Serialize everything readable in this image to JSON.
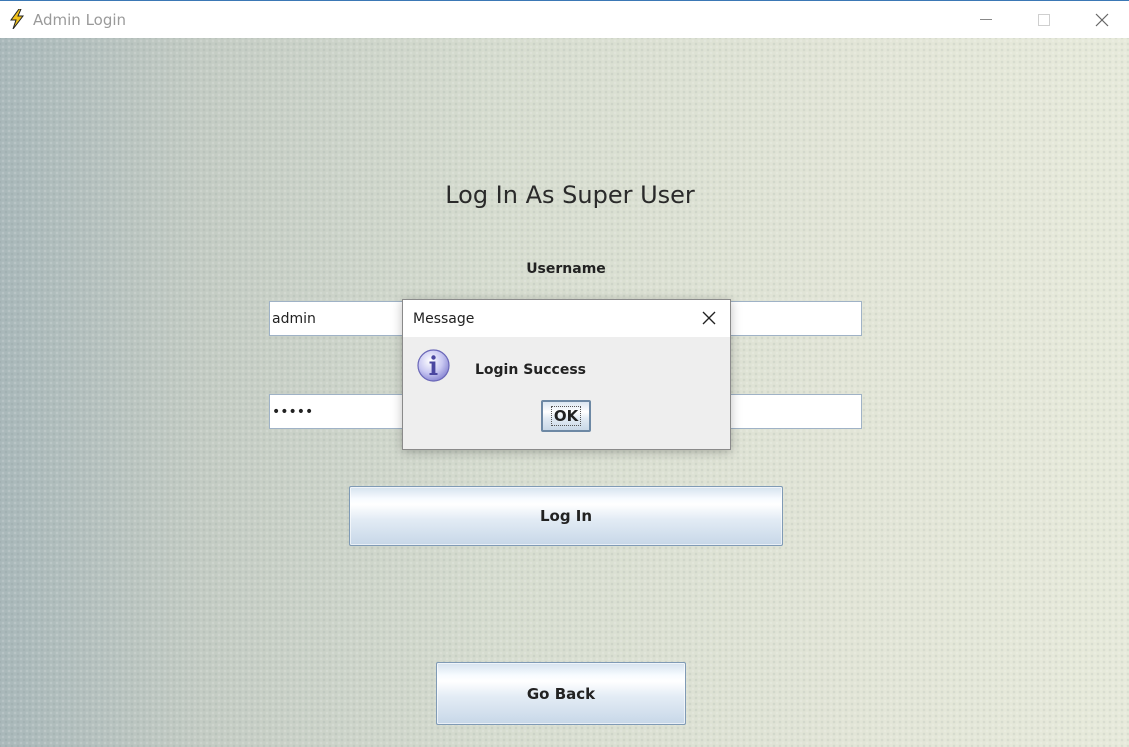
{
  "window": {
    "title": "Admin Login",
    "icon": "lightning-bolt-icon",
    "controls": [
      "minimize-icon",
      "maximize-icon",
      "close-icon"
    ]
  },
  "form": {
    "heading": "Log In As Super User",
    "username_label": "Username",
    "username_value": "admin",
    "password_value": "•••••",
    "login_label": "Log In",
    "go_back_label": "Go Back"
  },
  "dialog": {
    "title": "Message",
    "message": "Login Success",
    "ok_label": "OK",
    "icon": "info-icon"
  },
  "colors": {
    "button_border": "#7f9ab5",
    "window_accent": "#3b78b5",
    "lightning": "#f2c21a"
  }
}
